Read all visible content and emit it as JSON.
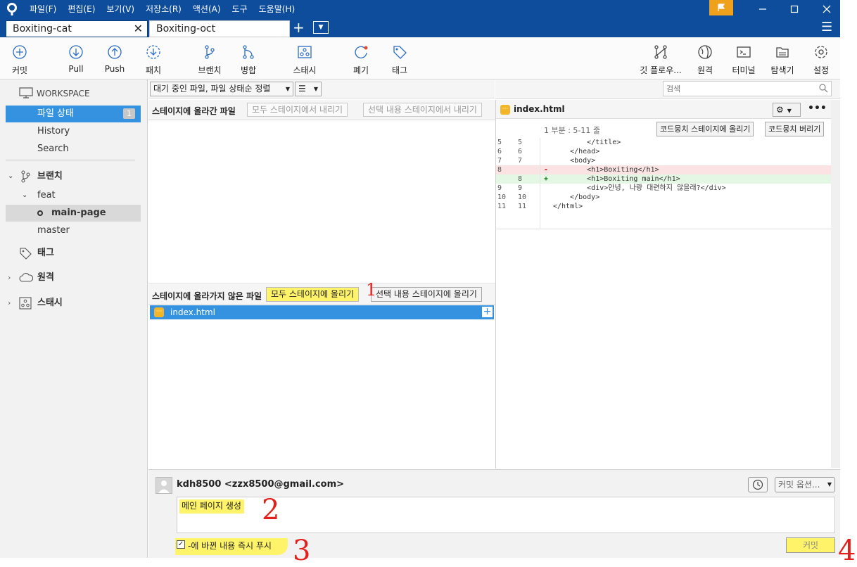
{
  "menu": [
    "파일(F)",
    "편집(E)",
    "보기(V)",
    "저장소(R)",
    "액션(A)",
    "도구",
    "도움말(H)"
  ],
  "tabs": [
    {
      "label": "Boxiting-cat",
      "active": true
    },
    {
      "label": "Boxiting-oct",
      "active": false
    }
  ],
  "toolbar": {
    "commit": "커밋",
    "pull": "Pull",
    "push": "Push",
    "patch": "패치",
    "branch": "브랜치",
    "merge": "병합",
    "stash": "스태시",
    "discard": "폐기",
    "tag": "태그",
    "gitflow": "깃 플로우...",
    "remote": "원격",
    "terminal": "터미널",
    "explorer": "탐색기",
    "settings": "설정"
  },
  "search": {
    "placeholder": "검색"
  },
  "sidebar": {
    "workspace": "WORKSPACE",
    "file_status": "파일 상태",
    "file_status_count": "1",
    "history": "History",
    "search": "Search",
    "branches": "브랜치",
    "feat": "feat",
    "main_page": "main-page",
    "master": "master",
    "tags": "태그",
    "remotes": "원격",
    "stashes": "스태시"
  },
  "filter": {
    "sort": "대기 중인 파일, 파일 상태순 정렬"
  },
  "staged": {
    "title": "스테이지에 올라간 파일",
    "unstage_all": "모두 스테이지에서 내리기",
    "unstage_selected": "선택 내용 스테이지에서 내리기"
  },
  "unstaged": {
    "title": "스테이지에 올라가지 않은 파일",
    "stage_all": "모두 스테이지에 올리기",
    "stage_selected": "선택 내용 스테이지에 올리기",
    "files": [
      {
        "name": "index.html"
      }
    ]
  },
  "diff": {
    "filename": "index.html",
    "hunk": "1 부분 : 5-11 줄",
    "stage_hunk": "코드뭉치 스테이지에 올리기",
    "discard_hunk": "코드뭉치 버리기",
    "lines": [
      {
        "o": "5",
        "n": "5",
        "s": "",
        "t": "        </title>",
        "k": "ctx"
      },
      {
        "o": "6",
        "n": "6",
        "s": "",
        "t": "    </head>",
        "k": "ctx"
      },
      {
        "o": "7",
        "n": "7",
        "s": "",
        "t": "    <body>",
        "k": "ctx"
      },
      {
        "o": "8",
        "n": "",
        "s": "-",
        "t": "        <h1>Boxiting</h1>",
        "k": "rem"
      },
      {
        "o": "",
        "n": "8",
        "s": "+",
        "t": "        <h1>Boxiting main</h1>",
        "k": "add"
      },
      {
        "o": "9",
        "n": "9",
        "s": "",
        "t": "        <div>안녕, 나랑 대련하지 않을래?</div>",
        "k": "ctx"
      },
      {
        "o": "10",
        "n": "10",
        "s": "",
        "t": "    </body>",
        "k": "ctx"
      },
      {
        "o": "11",
        "n": "11",
        "s": "",
        "t": "</html>",
        "k": "ctx"
      }
    ]
  },
  "commit": {
    "author": "kdh8500 <zzx8500@gmail.com>",
    "message": "메인 페이지 생성",
    "options": "커밋 옵션...",
    "push_label": "-에 바뀐 내용 즉시 푸시",
    "button": "커밋"
  },
  "annotations": {
    "a1": "1",
    "a2": "2",
    "a3": "3",
    "a4": "4"
  }
}
